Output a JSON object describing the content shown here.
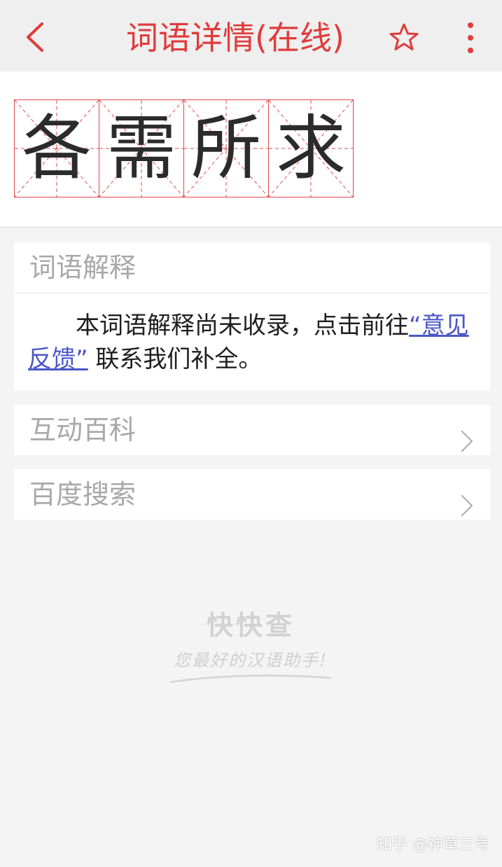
{
  "header": {
    "title": "词语详情(在线)",
    "back_icon": "chevron-left-icon",
    "star_icon": "star-outline-icon",
    "more_icon": "more-vertical-icon",
    "accent_color": "#e13b3b"
  },
  "word": {
    "chars": [
      "各",
      "需",
      "所",
      "求"
    ]
  },
  "definition": {
    "title": "词语解释",
    "text": "本词语解释尚未收录，点击前往",
    "link": "“意见反馈”",
    "text_after": " 联系我们补全。"
  },
  "baike": {
    "title": "互动百科"
  },
  "baidu": {
    "title": "百度搜索"
  },
  "brand": {
    "name": "快快查",
    "slogan": "您最好的汉语助手!"
  },
  "watermark": "知乎 @神草三号"
}
